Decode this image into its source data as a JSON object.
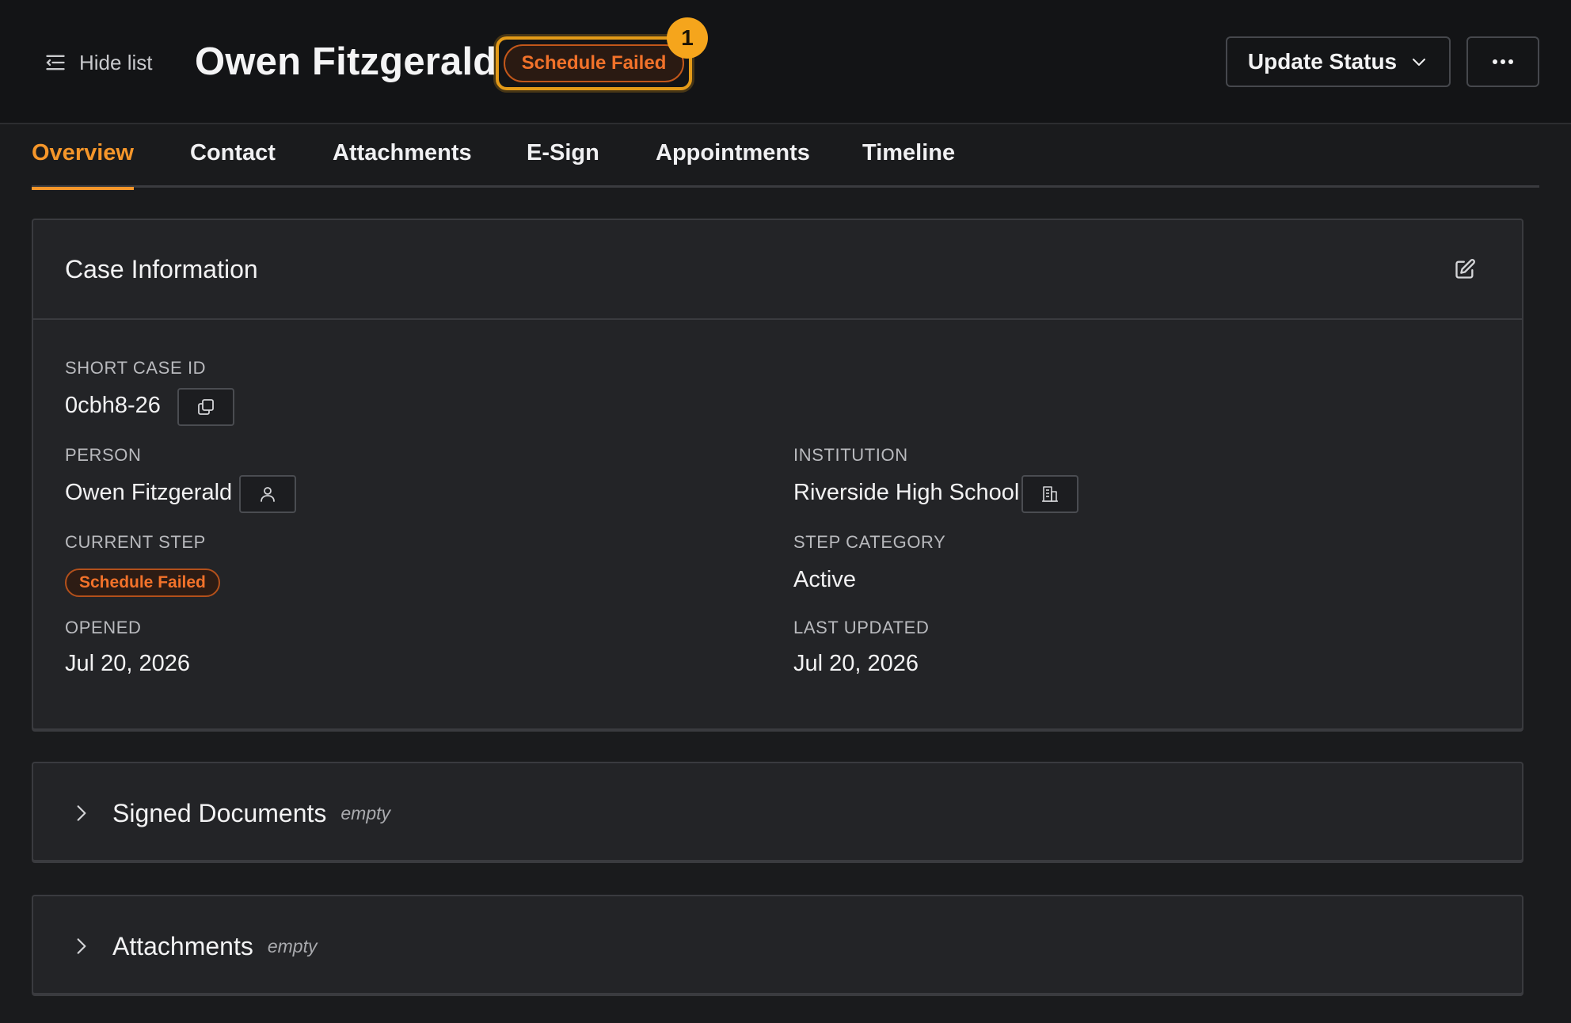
{
  "header": {
    "hide_list_label": "Hide list",
    "title": "Owen Fitzgerald",
    "status_label": "Schedule Failed",
    "status_count": "1",
    "update_status_label": "Update Status",
    "more_label": "•••"
  },
  "tabs": [
    {
      "label": "Overview",
      "active": true
    },
    {
      "label": "Contact"
    },
    {
      "label": "Attachments"
    },
    {
      "label": "E-Sign"
    },
    {
      "label": "Appointments"
    },
    {
      "label": "Timeline"
    }
  ],
  "case_info": {
    "title": "Case Information",
    "short_case_id_label": "SHORT CASE ID",
    "short_case_id": "0cbh8-26",
    "person_label": "PERSON",
    "person": "Owen Fitzgerald",
    "institution_label": "INSTITUTION",
    "institution": "Riverside High School",
    "current_step_label": "CURRENT STEP",
    "current_step": "Schedule Failed",
    "step_category_label": "STEP CATEGORY",
    "step_category": "Active",
    "opened_label": "OPENED",
    "opened": "Jul 20, 2026",
    "last_updated_label": "LAST UPDATED",
    "last_updated": "Jul 20, 2026"
  },
  "sections": [
    {
      "title": "Signed Documents",
      "state": "empty"
    },
    {
      "title": "Attachments",
      "state": "empty"
    }
  ],
  "colors": {
    "accent": "#f5962a",
    "status_orange": "#f2722a",
    "badge": "#f5a51c",
    "background": "#1a1b1d",
    "card": "#232427"
  },
  "icons": {
    "hide_list": "list-collapse-icon",
    "dropdown": "chevron-down-icon",
    "more": "ellipsis-icon",
    "edit": "edit-icon",
    "copy": "copy-icon",
    "person": "user-icon",
    "institution": "building-icon",
    "expand": "chevron-right-icon"
  }
}
